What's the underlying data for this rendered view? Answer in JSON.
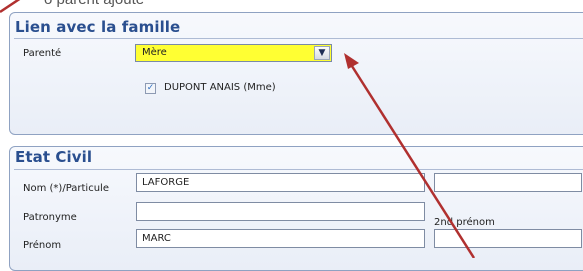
{
  "header_fragment": "o  parent ajouté",
  "section_lien": {
    "title": "Lien avec la famille",
    "parente_label": "Parenté",
    "parente_value": "Mère",
    "checkbox_label": "DUPONT ANAIS (Mme)",
    "checkbox_checked": true
  },
  "section_etat_civil": {
    "title": "Etat Civil",
    "nom_label": "Nom (*)/Particule",
    "nom_value": "LAFORGE",
    "particule_value": "",
    "patronyme_label": "Patronyme",
    "patronyme_value": "",
    "second_prenom_label": "2nd prénom",
    "prenom_label": "Prénom",
    "prenom_value": "MARC",
    "second_prenom_value": ""
  },
  "colors": {
    "panel_border": "#8fa2c2",
    "title_blue": "#2a4f8f",
    "select_highlight": "#ffff33",
    "annotation_arrow": "#b0302f"
  }
}
